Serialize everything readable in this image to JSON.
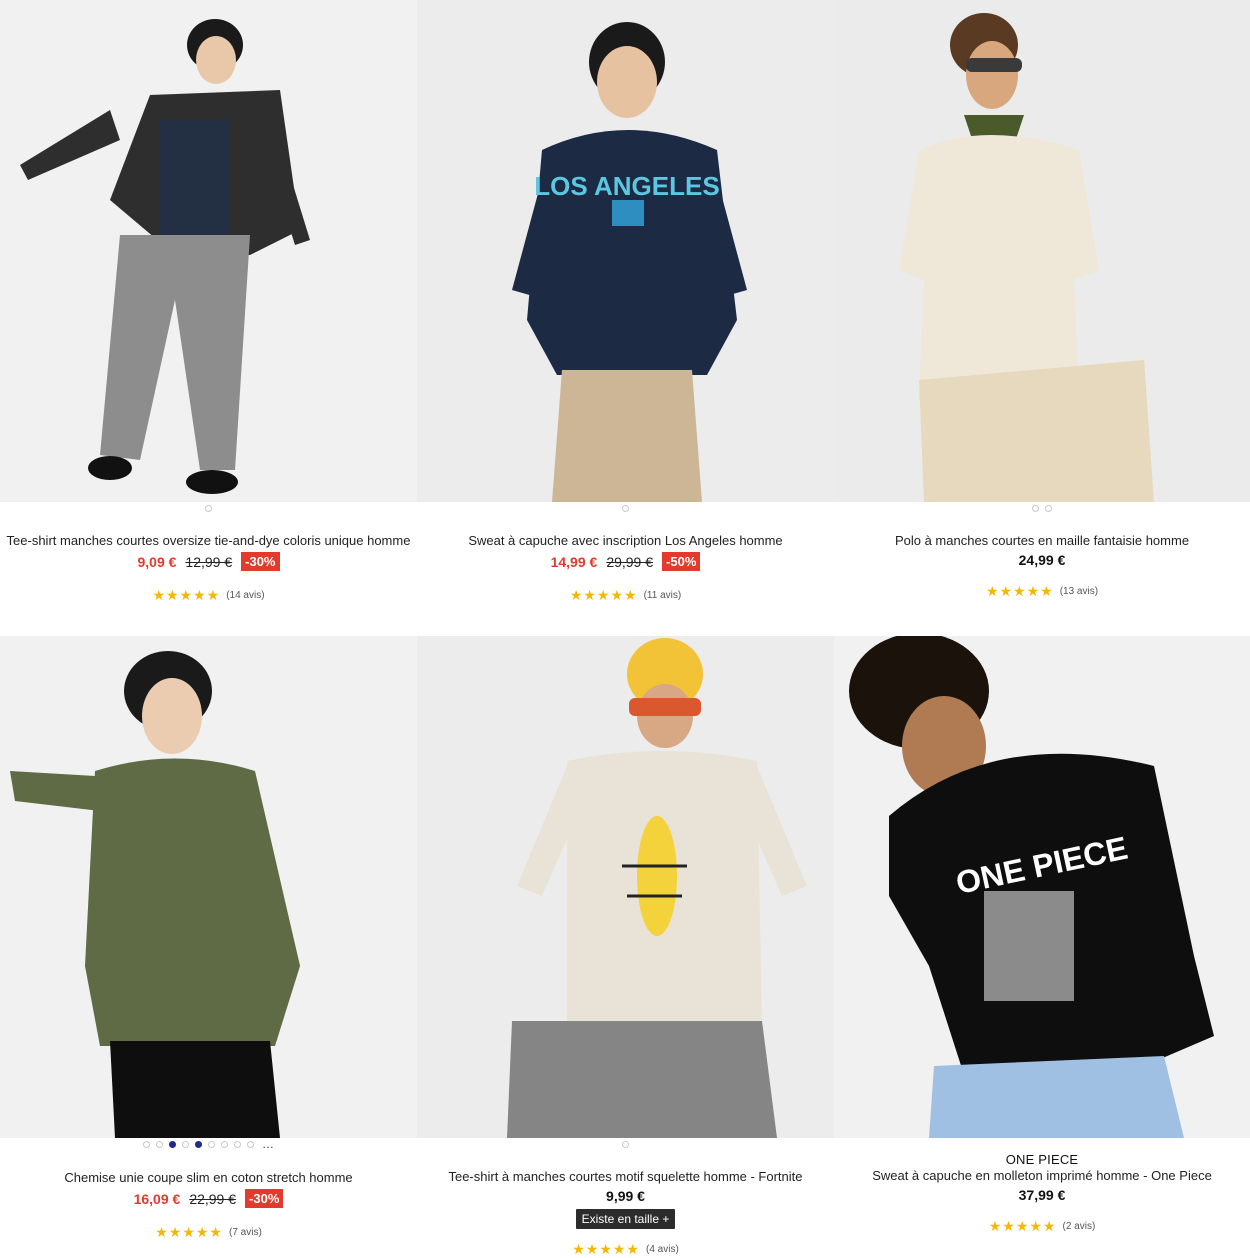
{
  "products": [
    {
      "brand": "",
      "title": "Tee-shirt manches courtes oversize tie-and-dye coloris unique homme",
      "price": "9,09 €",
      "old_price": "12,99 €",
      "discount": "-30%",
      "stars": "★★★★★",
      "rating": 4.5,
      "reviews": "(14 avis)",
      "badge": "",
      "dots": 1,
      "active_dot": 0
    },
    {
      "brand": "",
      "title": "Sweat à capuche avec inscription Los Angeles homme",
      "price": "14,99 €",
      "old_price": "29,99 €",
      "discount": "-50%",
      "stars": "★★★★★",
      "rating": 5,
      "reviews": "(11 avis)",
      "badge": "",
      "dots": 1,
      "active_dot": 0,
      "print_text": "LOS ANGELES"
    },
    {
      "brand": "",
      "title": "Polo à manches courtes en maille fantaisie homme",
      "price": "24,99 €",
      "old_price": "",
      "discount": "",
      "stars": "★★★★★",
      "rating": 5,
      "reviews": "(13 avis)",
      "badge": "",
      "dots": 2,
      "active_dot": 0
    },
    {
      "brand": "",
      "title": "Chemise unie coupe slim en coton stretch homme",
      "price": "16,09 €",
      "old_price": "22,99 €",
      "discount": "-30%",
      "stars": "★★★★★",
      "rating": 5,
      "reviews": "(7 avis)",
      "badge": "",
      "dots": 9,
      "active_dot": 2,
      "more": "…"
    },
    {
      "brand": "",
      "title": "Tee-shirt à manches courtes motif squelette homme - Fortnite",
      "price": "9,99 €",
      "old_price": "",
      "discount": "",
      "stars": "★★★★★",
      "rating": 4.5,
      "reviews": "(4 avis)",
      "badge": "Existe en taille +",
      "dots": 1,
      "active_dot": 0
    },
    {
      "brand": "ONE PIECE",
      "title": "Sweat à capuche en molleton imprimé homme - One Piece",
      "price": "37,99 €",
      "old_price": "",
      "discount": "",
      "stars": "★★★★★",
      "rating": 5,
      "reviews": "(2 avis)",
      "badge": "",
      "dots": 0,
      "active_dot": 0,
      "print_text": "ONE PIECE"
    }
  ],
  "colors": {
    "sale": "#e23b2e",
    "star": "#f5b800",
    "dot_active": "#1f2a8a"
  }
}
